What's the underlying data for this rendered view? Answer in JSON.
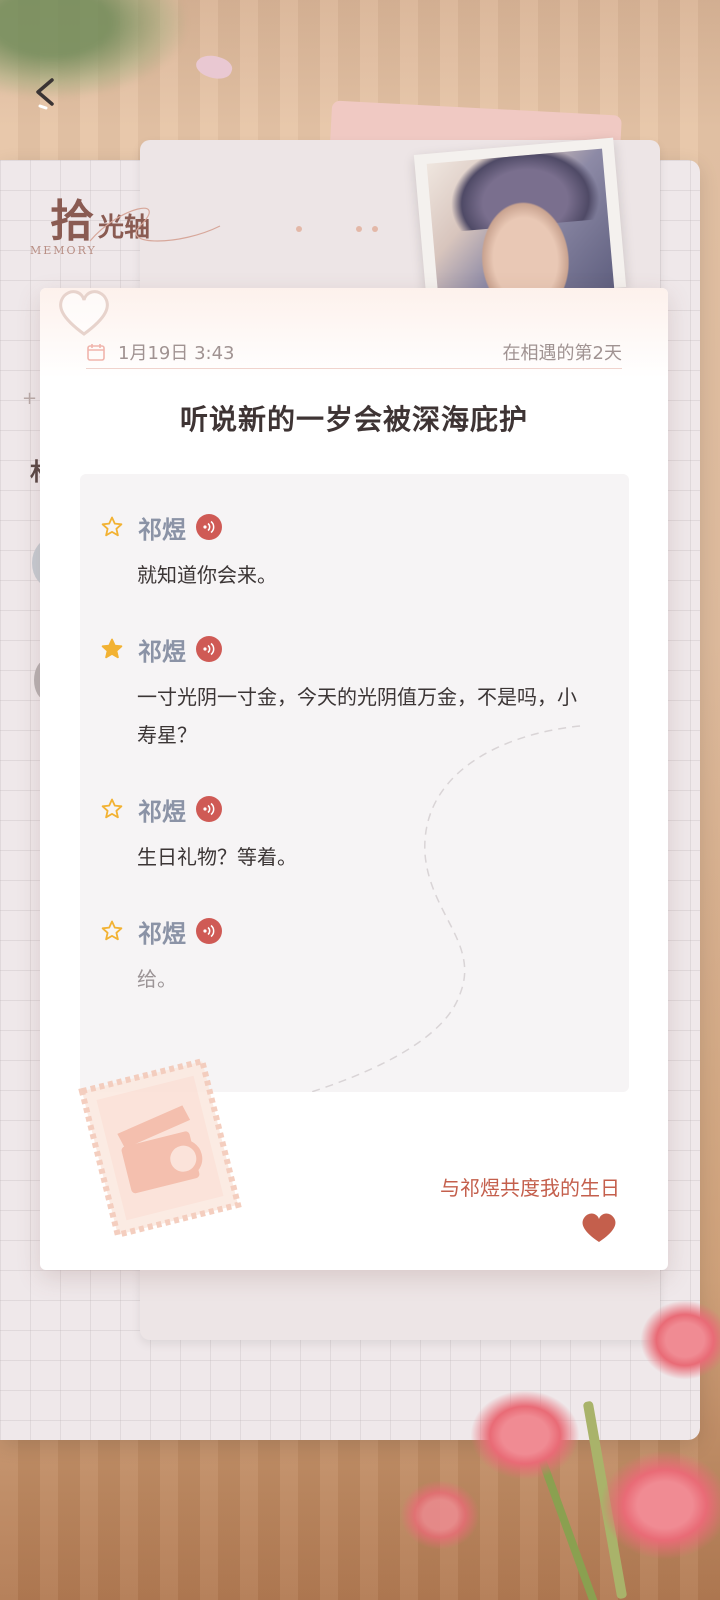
{
  "header": {
    "title_big": "拾",
    "title_small": "光轴",
    "subtitle": "MEMORY"
  },
  "card": {
    "date": "1月19日 3:43",
    "days_since": "在相遇的第2天",
    "headline": "听说新的一岁会被深海庇护",
    "messages": [
      {
        "speaker": "祁煜",
        "text": "就知道你会来。",
        "starred": false
      },
      {
        "speaker": "祁煜",
        "text": "一寸光阴一寸金，今天的光阴值万金，不是吗，小寿星？",
        "starred": true
      },
      {
        "speaker": "祁煜",
        "text": "生日礼物？等着。",
        "starred": false
      },
      {
        "speaker": "祁煜",
        "text": "给。",
        "starred": false
      }
    ],
    "footer_label": "与祁煜共度我的生日"
  },
  "background": {
    "left_plus": "+",
    "left_char": "林"
  },
  "icons": {
    "back": "chevron-left-icon",
    "calendar": "calendar-icon",
    "star_empty": "star-outline-icon",
    "star_filled": "star-filled-icon",
    "voice": "voice-play-icon",
    "heart": "heart-icon",
    "stamp": "film-stamp-icon"
  },
  "colors": {
    "accent": "#cf5a55",
    "speaker": "#8b93a6",
    "star": "#f2b233",
    "footer": "#c45f4c"
  }
}
